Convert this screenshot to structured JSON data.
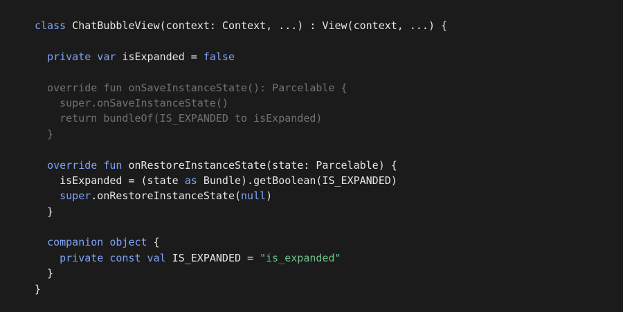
{
  "colors": {
    "background": "#1b1b1c",
    "keyword": "#7fa3f4",
    "identifier": "#e6e6e6",
    "string": "#6fc28b"
  },
  "code": {
    "lines": [
      {
        "dim": false,
        "tokens": [
          {
            "t": "kw",
            "v": "class"
          },
          {
            "t": "id",
            "v": " ChatBubbleView(context: Context, ...) : View(context, ...) {"
          }
        ]
      },
      {
        "dim": false,
        "tokens": []
      },
      {
        "dim": false,
        "tokens": [
          {
            "t": "id",
            "v": "  "
          },
          {
            "t": "kw",
            "v": "private var"
          },
          {
            "t": "id",
            "v": " isExpanded = "
          },
          {
            "t": "kw",
            "v": "false"
          }
        ]
      },
      {
        "dim": false,
        "tokens": []
      },
      {
        "dim": true,
        "tokens": [
          {
            "t": "id",
            "v": "  override fun onSaveInstanceState(): Parcelable {"
          }
        ]
      },
      {
        "dim": true,
        "tokens": [
          {
            "t": "id",
            "v": "    super.onSaveInstanceState()"
          }
        ]
      },
      {
        "dim": true,
        "tokens": [
          {
            "t": "id",
            "v": "    return bundleOf(IS_EXPANDED to isExpanded)"
          }
        ]
      },
      {
        "dim": true,
        "tokens": [
          {
            "t": "id",
            "v": "  }"
          }
        ]
      },
      {
        "dim": false,
        "tokens": []
      },
      {
        "dim": false,
        "tokens": [
          {
            "t": "id",
            "v": "  "
          },
          {
            "t": "kw",
            "v": "override fun"
          },
          {
            "t": "id",
            "v": " onRestoreInstanceState(state: Parcelable) {"
          }
        ]
      },
      {
        "dim": false,
        "tokens": [
          {
            "t": "id",
            "v": "    isExpanded = (state "
          },
          {
            "t": "kw",
            "v": "as"
          },
          {
            "t": "id",
            "v": " Bundle).getBoolean(IS_EXPANDED)"
          }
        ]
      },
      {
        "dim": false,
        "tokens": [
          {
            "t": "id",
            "v": "    "
          },
          {
            "t": "kw",
            "v": "super"
          },
          {
            "t": "id",
            "v": ".onRestoreInstanceState("
          },
          {
            "t": "kw",
            "v": "null"
          },
          {
            "t": "id",
            "v": ")"
          }
        ]
      },
      {
        "dim": false,
        "tokens": [
          {
            "t": "id",
            "v": "  }"
          }
        ]
      },
      {
        "dim": false,
        "tokens": []
      },
      {
        "dim": false,
        "tokens": [
          {
            "t": "id",
            "v": "  "
          },
          {
            "t": "kw",
            "v": "companion object"
          },
          {
            "t": "id",
            "v": " {"
          }
        ]
      },
      {
        "dim": false,
        "tokens": [
          {
            "t": "id",
            "v": "    "
          },
          {
            "t": "kw",
            "v": "private const val"
          },
          {
            "t": "id",
            "v": " IS_EXPANDED = "
          },
          {
            "t": "str",
            "v": "\"is_expanded\""
          }
        ]
      },
      {
        "dim": false,
        "tokens": [
          {
            "t": "id",
            "v": "  }"
          }
        ]
      },
      {
        "dim": false,
        "tokens": [
          {
            "t": "id",
            "v": "}"
          }
        ]
      }
    ]
  }
}
